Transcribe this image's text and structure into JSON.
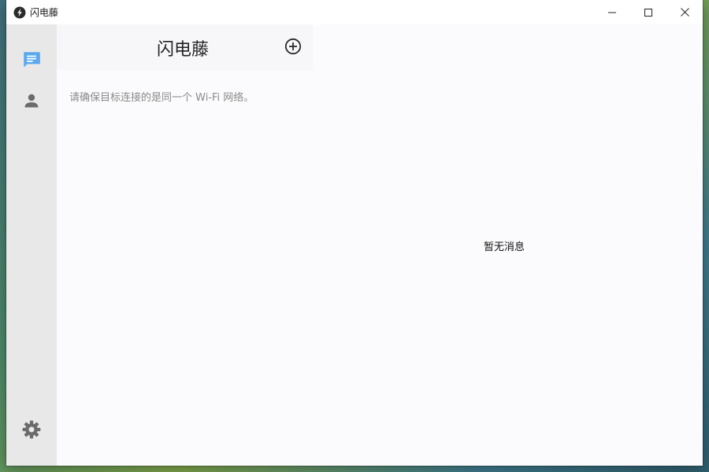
{
  "window": {
    "title": "闪电藤"
  },
  "sidebar": {
    "items": [
      {
        "icon": "chat-icon",
        "active": true
      },
      {
        "icon": "person-icon",
        "active": false
      }
    ],
    "bottom": {
      "icon": "gear-icon"
    }
  },
  "list": {
    "title": "闪电藤",
    "hint": "请确保目标连接的是同一个 Wi-Fi 网络。"
  },
  "main": {
    "empty_text": "暂无消息"
  },
  "colors": {
    "accent": "#5aa9ec",
    "icon_gray": "#6b6b6b",
    "sidebar_bg": "#e8e8e8"
  }
}
